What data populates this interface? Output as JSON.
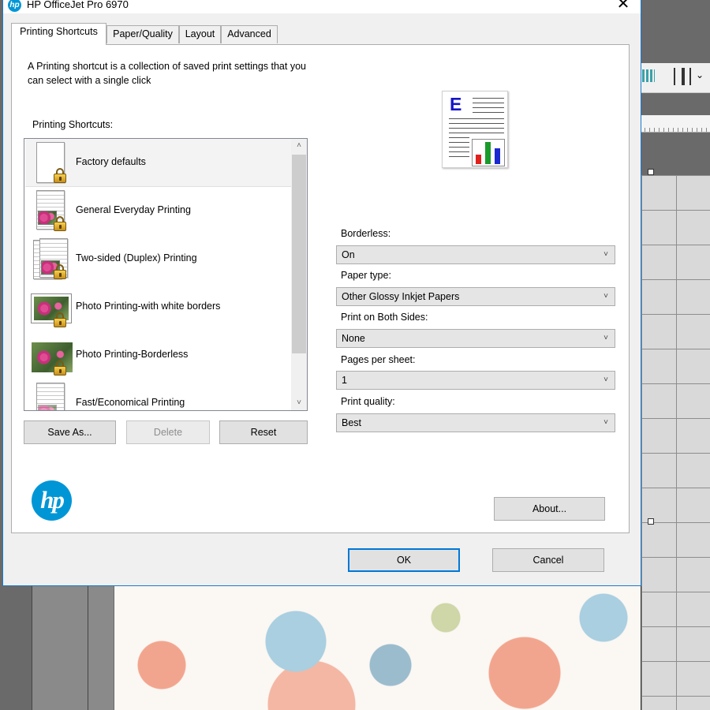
{
  "window": {
    "title": "HP OfficeJet Pro 6970",
    "app_icon": "hp-icon",
    "close_icon": "close-icon",
    "close_glyph": "✕",
    "app_icon_text": "hp"
  },
  "tabs": [
    {
      "label": "Printing Shortcuts",
      "active": true
    },
    {
      "label": "Paper/Quality",
      "active": false
    },
    {
      "label": "Layout",
      "active": false
    },
    {
      "label": "Advanced",
      "active": false
    }
  ],
  "intro": {
    "text": "A Printing shortcut is a collection of saved print settings that you can select with a single click"
  },
  "shortcuts": {
    "label": "Printing Shortcuts:",
    "items": [
      {
        "label": "Factory defaults",
        "icon": "blank-document-lock-icon",
        "selected": true
      },
      {
        "label": "General Everyday Printing",
        "icon": "document-photo-lock-icon"
      },
      {
        "label": "Two-sided (Duplex) Printing",
        "icon": "duplex-document-lock-icon"
      },
      {
        "label": "Photo Printing-with white borders",
        "icon": "bordered-photo-lock-icon"
      },
      {
        "label": "Photo Printing-Borderless",
        "icon": "borderless-photo-lock-icon"
      },
      {
        "label": "Fast/Economical Printing",
        "icon": "economical-document-icon"
      }
    ],
    "buttons": {
      "save_as": "Save As...",
      "delete": "Delete",
      "reset": "Reset"
    }
  },
  "preview": {
    "icon": "document-preview-icon",
    "letter": "E",
    "bar_colors": [
      "#e0201a",
      "#1a9a2a",
      "#1a2ad0"
    ]
  },
  "settings": {
    "borderless": {
      "label": "Borderless:",
      "value": "On"
    },
    "paper_type": {
      "label": "Paper type:",
      "value": "Other Glossy Inkjet Papers"
    },
    "both_sides": {
      "label": "Print on Both Sides:",
      "value": "None"
    },
    "pages_per_sheet": {
      "label": "Pages per sheet:",
      "value": "1"
    },
    "print_quality": {
      "label": "Print quality:",
      "value": "Best"
    }
  },
  "logo": {
    "text": "hp",
    "color": "#0096d6"
  },
  "about_label": "About...",
  "footer": {
    "ok": "OK",
    "cancel": "Cancel"
  },
  "caret_glyph": "˅",
  "scroll_up_glyph": "˄",
  "scroll_down_glyph": "˅"
}
